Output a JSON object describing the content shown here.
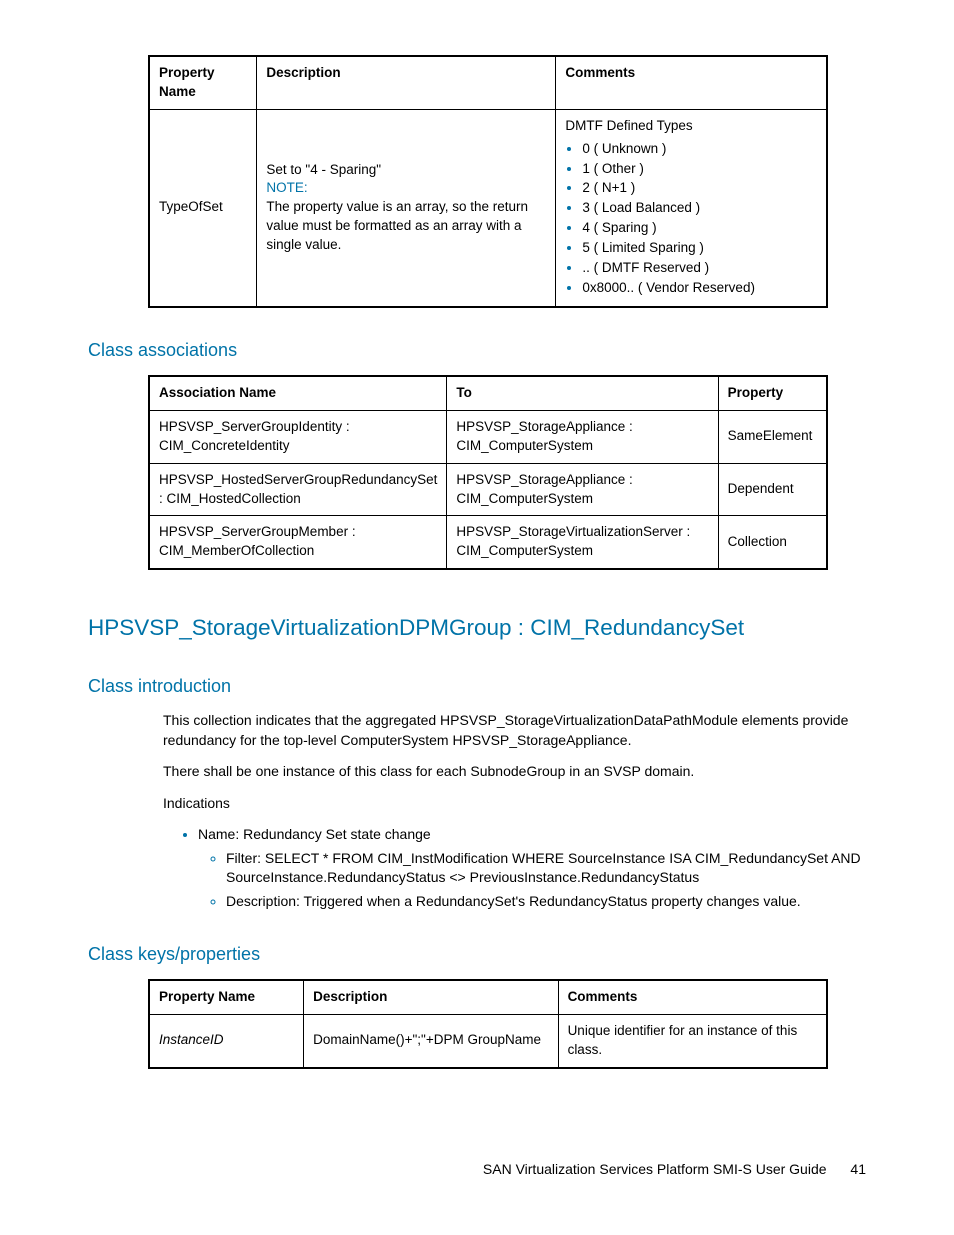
{
  "table1": {
    "headers": [
      "Property Name",
      "Description",
      "Comments"
    ],
    "row": {
      "name": "TypeOfSet",
      "desc_set": "Set to \"4 - Sparing\"",
      "desc_note_label": "NOTE:",
      "desc_note": "The property value is an array, so the return value must be formatted as an array with a single value.",
      "comments_head": "DMTF Defined Types",
      "comments_items": [
        "0 ( Unknown )",
        "1 ( Other )",
        "2 ( N+1 )",
        "3 ( Load Balanced )",
        "4 ( Sparing )",
        "5 ( Limited Sparing )",
        ".. ( DMTF Reserved )",
        "0x8000.. ( Vendor Reserved)"
      ]
    }
  },
  "sec_assoc": {
    "title": "Class associations",
    "headers": [
      "Association Name",
      "To",
      "Property"
    ],
    "rows": [
      {
        "a": "HPSVSP_ServerGroupIdentity : CIM_ConcreteIdentity",
        "b": "HPSVSP_StorageAppliance : CIM_ComputerSystem",
        "c": "SameElement"
      },
      {
        "a": "HPSVSP_HostedServerGroupRedundancySet : CIM_HostedCollection",
        "b": "HPSVSP_StorageAppliance : CIM_ComputerSystem",
        "c": "Dependent"
      },
      {
        "a": "HPSVSP_ServerGroupMember : CIM_MemberOfCollection",
        "b": "HPSVSP_StorageVirtualizationServer : CIM_ComputerSystem",
        "c": "Collection"
      }
    ]
  },
  "heading2": "HPSVSP_StorageVirtualizationDPMGroup : CIM_RedundancySet",
  "sec_intro": {
    "title": "Class introduction",
    "p1": "This collection indicates that the aggregated HPSVSP_StorageVirtualizationDataPathModule elements provide redundancy for the top-level ComputerSystem HPSVSP_StorageAppliance.",
    "p2": "There shall be one instance of this class for each SubnodeGroup in an SVSP domain.",
    "p3": "Indications",
    "li1": "Name: Redundancy Set state change",
    "li1a": "Filter: SELECT * FROM CIM_InstModification WHERE SourceInstance ISA CIM_RedundancySet AND SourceInstance.RedundancyStatus <> PreviousInstance.RedundancyStatus",
    "li1b": "Description: Triggered when a RedundancySet's RedundancyStatus property changes value."
  },
  "sec_keys": {
    "title": "Class keys/properties",
    "headers": [
      "Property Name",
      "Description",
      "Comments"
    ],
    "rows": [
      {
        "a": "InstanceID",
        "b": "DomainName()+\";\"+DPM GroupName",
        "c": "Unique identifier for an instance of this class."
      }
    ]
  },
  "footer": {
    "title": "SAN Virtualization Services Platform SMI-S User Guide",
    "page": "41"
  }
}
